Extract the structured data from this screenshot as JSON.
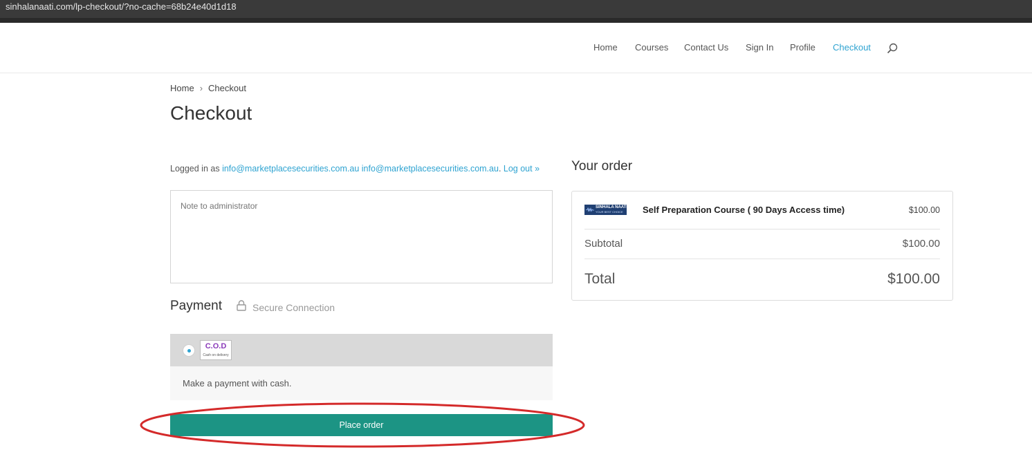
{
  "browser": {
    "url": "sinhalanaati.com/lp-checkout/?no-cache=68b24e40d1d18"
  },
  "nav": {
    "items": [
      {
        "label": "Home",
        "active": false
      },
      {
        "label": "Courses",
        "active": false
      },
      {
        "label": "Contact Us",
        "active": false
      },
      {
        "label": "Sign In",
        "active": false
      },
      {
        "label": "Profile",
        "active": false
      },
      {
        "label": "Checkout",
        "active": true
      }
    ],
    "search_icon": "search-icon"
  },
  "breadcrumb": {
    "home": "Home",
    "separator": "›",
    "current": "Checkout"
  },
  "page_title": "Checkout",
  "login": {
    "prefix": "Logged in as",
    "username": "info@marketplacesecurities.com.au",
    "email": "info@marketplacesecurities.com.au",
    "separator": ".",
    "logout": "Log out »"
  },
  "note": {
    "placeholder": "Note to administrator",
    "value": ""
  },
  "payment": {
    "title": "Payment",
    "secure_label": "Secure Connection",
    "method": {
      "logo_text": "C.O.D",
      "logo_subtext": "Cash on delivery",
      "selected": true,
      "description": "Make a payment with cash."
    },
    "place_order_label": "Place order"
  },
  "order": {
    "title": "Your order",
    "item": {
      "thumb_title": "SINHALA NAATI",
      "thumb_subtitle": "YOUR BEST CHOICE",
      "name": "Self Preparation Course ( 90 Days Access time)",
      "price": "$100.00"
    },
    "subtotal_label": "Subtotal",
    "subtotal_value": "$100.00",
    "total_label": "Total",
    "total_value": "$100.00"
  },
  "colors": {
    "accent": "#2ea3d1",
    "button": "#1c9484",
    "highlight": "#d42a2a",
    "cod_purple": "#8a3ab9"
  }
}
